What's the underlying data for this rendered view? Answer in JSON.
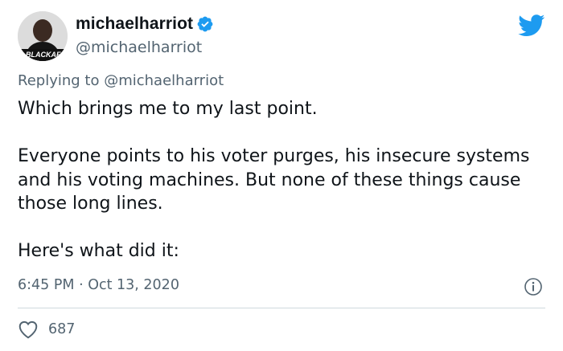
{
  "tweet": {
    "display_name": "michaelharriot",
    "handle": "@michaelharriot",
    "avatar_text": "BLACKAF",
    "reply_prefix": "Replying to",
    "reply_to": "@michaelharriot",
    "paragraphs": [
      "Which brings me to my last point.",
      "Everyone points to his voter purges, his insecure systems and his voting machines. But none of these things cause those long lines.",
      "Here's what did it:"
    ],
    "timestamp": "6:45 PM · Oct 13, 2020",
    "like_count": "687"
  },
  "icons": {
    "verified": "verified-badge-icon",
    "brand": "twitter-bird-icon",
    "info": "info-icon",
    "like": "heart-icon"
  },
  "colors": {
    "brand_blue": "#1d9bf0",
    "secondary_text": "#536471",
    "divider": "#cfd9de"
  }
}
